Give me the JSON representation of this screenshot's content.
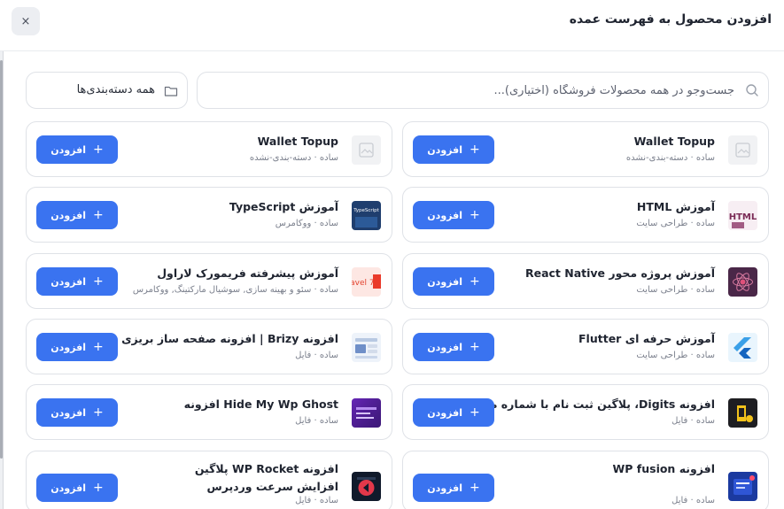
{
  "dialog": {
    "title": "افزودن محصول به فهرست عمده",
    "close_symbol": "×"
  },
  "search": {
    "placeholder": "جست‌وجو در همه محصولات فروشگاه (اختیاری)...",
    "value": ""
  },
  "category_filter": {
    "label": "همه دسته‌بندی‌ها"
  },
  "add_label": "افزودن",
  "add_plus": "+",
  "products": [
    {
      "name": "Wallet Topup",
      "meta": "ساده · دسته-بندی-نشده",
      "thumb": "placeholder"
    },
    {
      "name": "Wallet Topup",
      "meta": "ساده · دسته-بندی-نشده",
      "thumb": "placeholder"
    },
    {
      "name": "آموزش HTML",
      "meta": "ساده · طراحی سایت",
      "thumb": "html"
    },
    {
      "name": "آموزش TypeScript",
      "meta": "ساده · ووکامرس",
      "thumb": "typescript"
    },
    {
      "name": "آموزش پروژه محور React Native",
      "meta": "ساده · طراحی سایت",
      "thumb": "react-native"
    },
    {
      "name": "آموزش پیشرفته فریمورک لاراول",
      "meta": "ساده · سئو و بهینه سازی, سوشیال مارکتینگ, ووکامرس",
      "thumb": "laravel"
    },
    {
      "name": "آموزش حرفه ای Flutter",
      "meta": "ساده · طراحی سایت",
      "thumb": "flutter"
    },
    {
      "name": "افزونه Brizy | افزونه صفحه ساز بریزی پرو",
      "meta": "ساده · فایل",
      "thumb": "brizy"
    },
    {
      "name": "افزونه Digits، پلاگین ثبت نام با شماره موبایل",
      "meta": "ساده · فایل",
      "thumb": "digits"
    },
    {
      "name": "Hide My Wp Ghost افزونه",
      "meta": "ساده · فایل",
      "thumb": "hide-my-wp"
    },
    {
      "name": "افزونه WP fusion",
      "meta": "ساده · فایل",
      "thumb": "wp-fusion"
    },
    {
      "name": "افزونه WP Rocket پلاگین افزایش سرعت وردپرس",
      "meta": "ساده · فایل",
      "thumb": "wp-rocket"
    }
  ],
  "thumb_text": {
    "html": "HTML",
    "typescript": "TypeScript",
    "laravel": "ravel 7"
  },
  "colors": {
    "accent": "#3a73f0",
    "title": "#1f2430",
    "meta": "#7a7f8c",
    "border": "#dfe2e7"
  }
}
